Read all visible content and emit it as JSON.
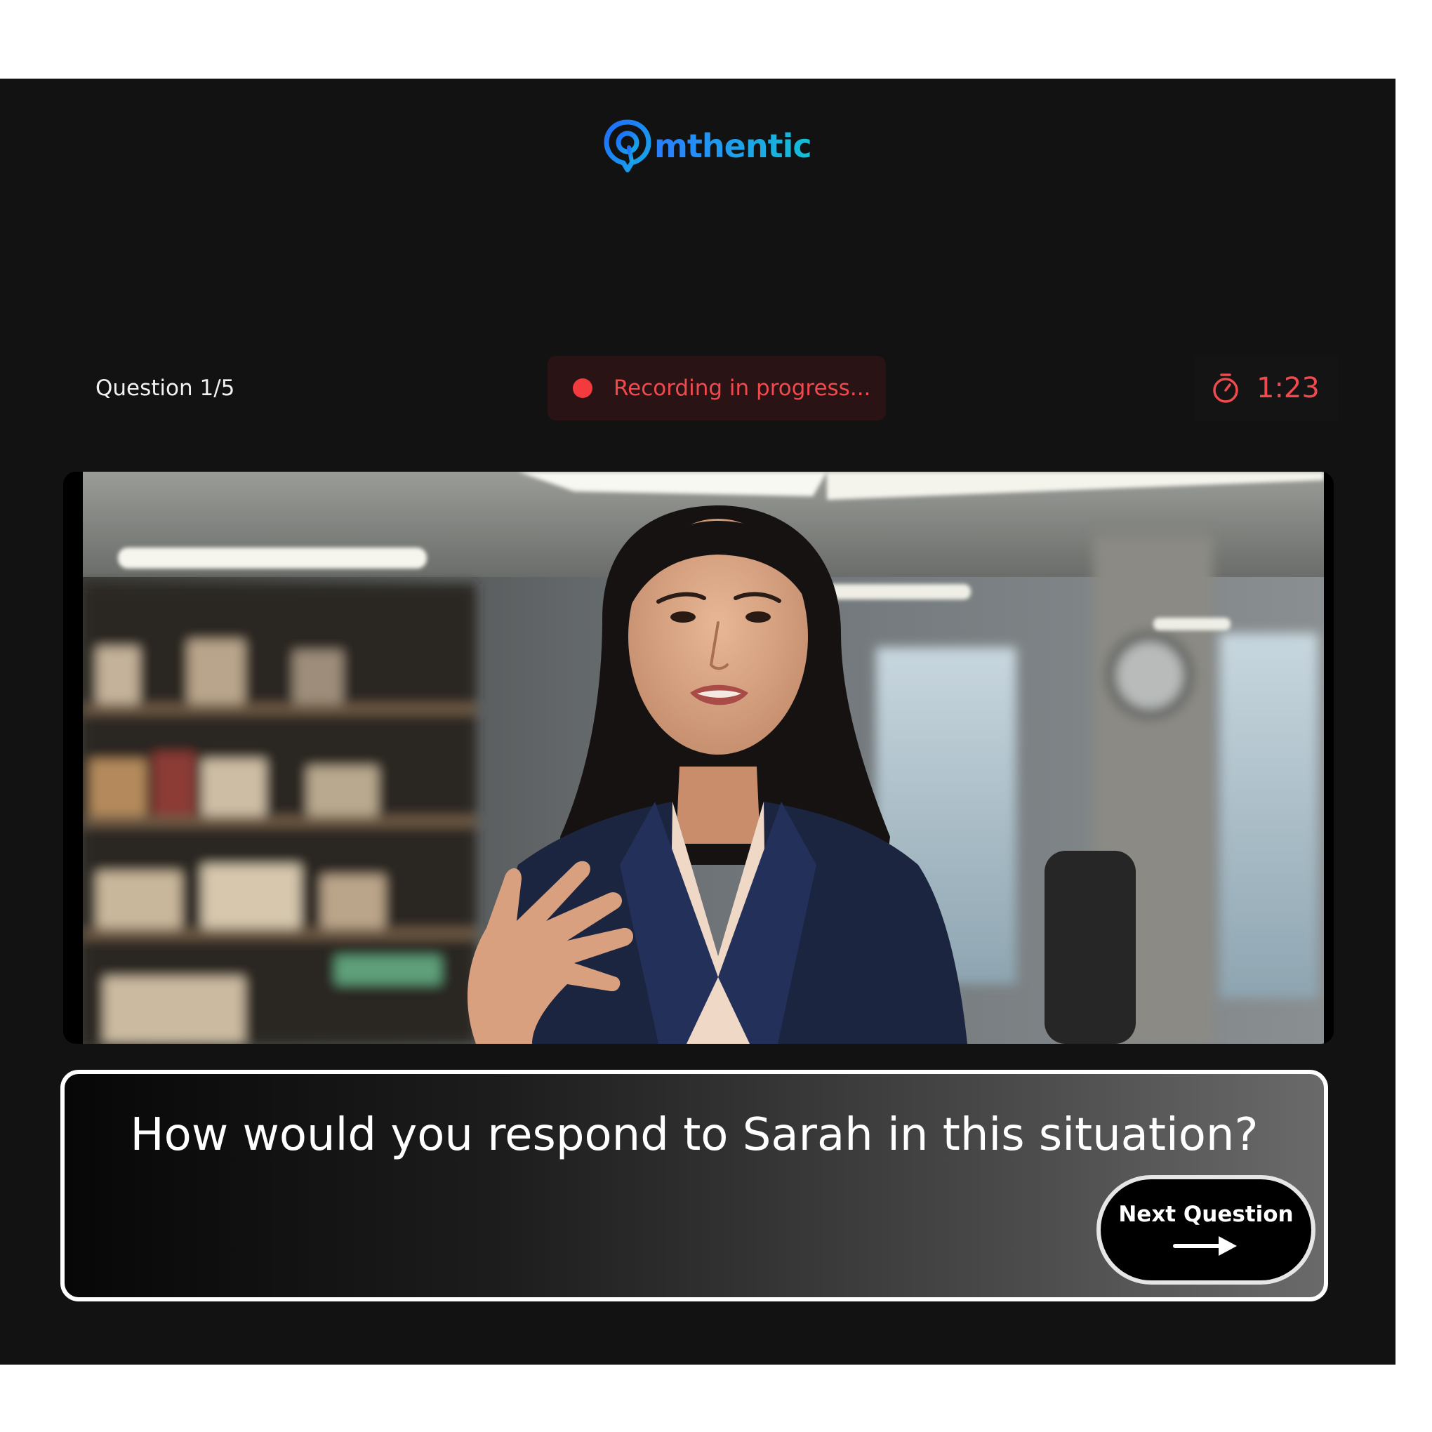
{
  "brand": {
    "name": "mthentic",
    "colors": {
      "gradient_start": "#2a7dff",
      "gradient_end": "#13c0d6"
    },
    "logo_icon": "location-pin-logo-icon"
  },
  "status": {
    "question_counter": "Question 1/5",
    "recording_text": "Recording in progress...",
    "recording_color": "#f04a4e",
    "timer_icon": "stopwatch-icon",
    "timer_value": "1:23"
  },
  "video": {
    "content": "interviewee-video-feed"
  },
  "question": {
    "text": "How would you respond to Sarah in this situation?"
  },
  "actions": {
    "next_label": "Next Question",
    "next_icon": "arrow-right-icon"
  }
}
